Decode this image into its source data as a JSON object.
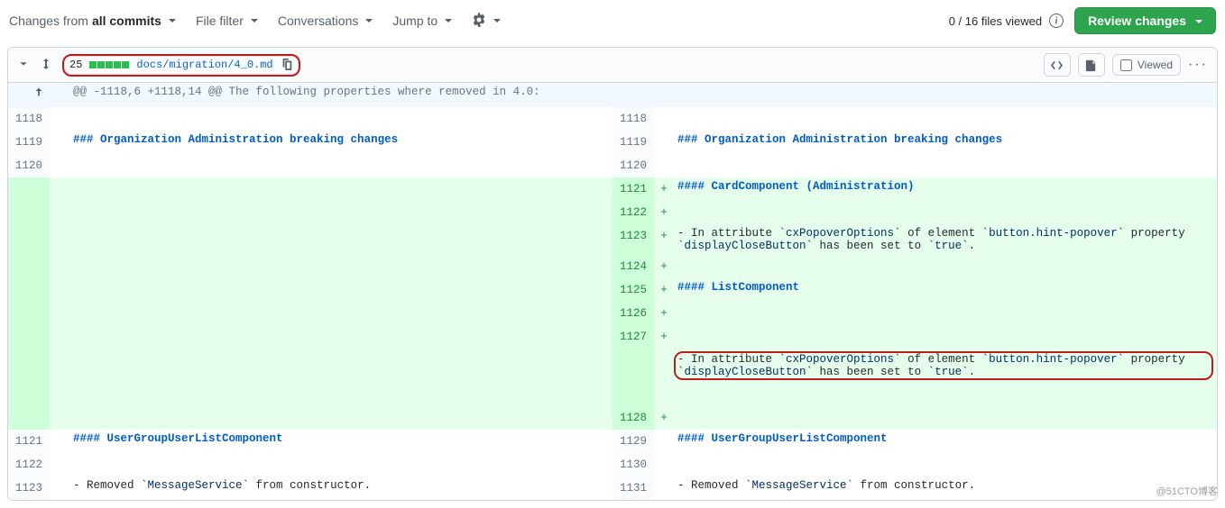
{
  "toolbar": {
    "changes_from_prefix": "Changes from ",
    "changes_from_value": "all commits",
    "file_filter": "File filter",
    "conversations": "Conversations",
    "jump_to": "Jump to",
    "files_viewed": "0 / 16 files viewed",
    "review_changes": "Review changes"
  },
  "file": {
    "diff_count": "25",
    "path": "docs/migration/4_0.md",
    "viewed_label": "Viewed"
  },
  "hunk": {
    "header": "@@ -1118,6 +1118,14 @@ The following properties where removed in 4.0:"
  },
  "left": {
    "r1": {
      "ln": "1118"
    },
    "r2": {
      "ln": "1119",
      "lead": "### ",
      "text": "Organization Administration breaking changes"
    },
    "r3": {
      "ln": "1120"
    },
    "r4": {
      "ln": "1121",
      "lead": "#### ",
      "text": "UserGroupUserListComponent"
    },
    "r5": {
      "ln": "1122"
    },
    "r6": {
      "ln": "1123",
      "pre": "- Removed `",
      "code": "MessageService",
      "post": "` from constructor."
    }
  },
  "right": {
    "r1": {
      "ln": "1118"
    },
    "r2": {
      "ln": "1119",
      "lead": "### ",
      "text": "Organization Administration breaking changes"
    },
    "r3": {
      "ln": "1120"
    },
    "r4": {
      "ln": "1121",
      "lead": "#### ",
      "text": "CardComponent (Administration)"
    },
    "r5": {
      "ln": "1122"
    },
    "r6": {
      "ln": "1123",
      "p1": "- In attribute `",
      "c1": "cxPopoverOptions",
      "p2": "` of element `",
      "c2": "button.hint-popover",
      "p3": "` property `",
      "c3": "displayCloseButton",
      "p4": "` has been set to `",
      "c4": "true",
      "p5": "`."
    },
    "r7": {
      "ln": "1124"
    },
    "r8": {
      "ln": "1125",
      "lead": "#### ",
      "text": "ListComponent"
    },
    "r9": {
      "ln": "1126"
    },
    "r10": {
      "ln": "1127",
      "p1": "- In attribute `",
      "c1": "cxPopoverOptions",
      "p2": "` of element `",
      "c2": "button.hint-popover",
      "p3": "` property `",
      "c3": "displayCloseButton",
      "p4": "` has been set to `",
      "c4": "true",
      "p5": "`."
    },
    "r11": {
      "ln": "1128"
    },
    "r12": {
      "ln": "1129",
      "lead": "#### ",
      "text": "UserGroupUserListComponent"
    },
    "r13": {
      "ln": "1130"
    },
    "r14": {
      "ln": "1131",
      "pre": "- Removed `",
      "code": "MessageService",
      "post": "` from constructor."
    }
  },
  "watermark": "@51CTO博客"
}
